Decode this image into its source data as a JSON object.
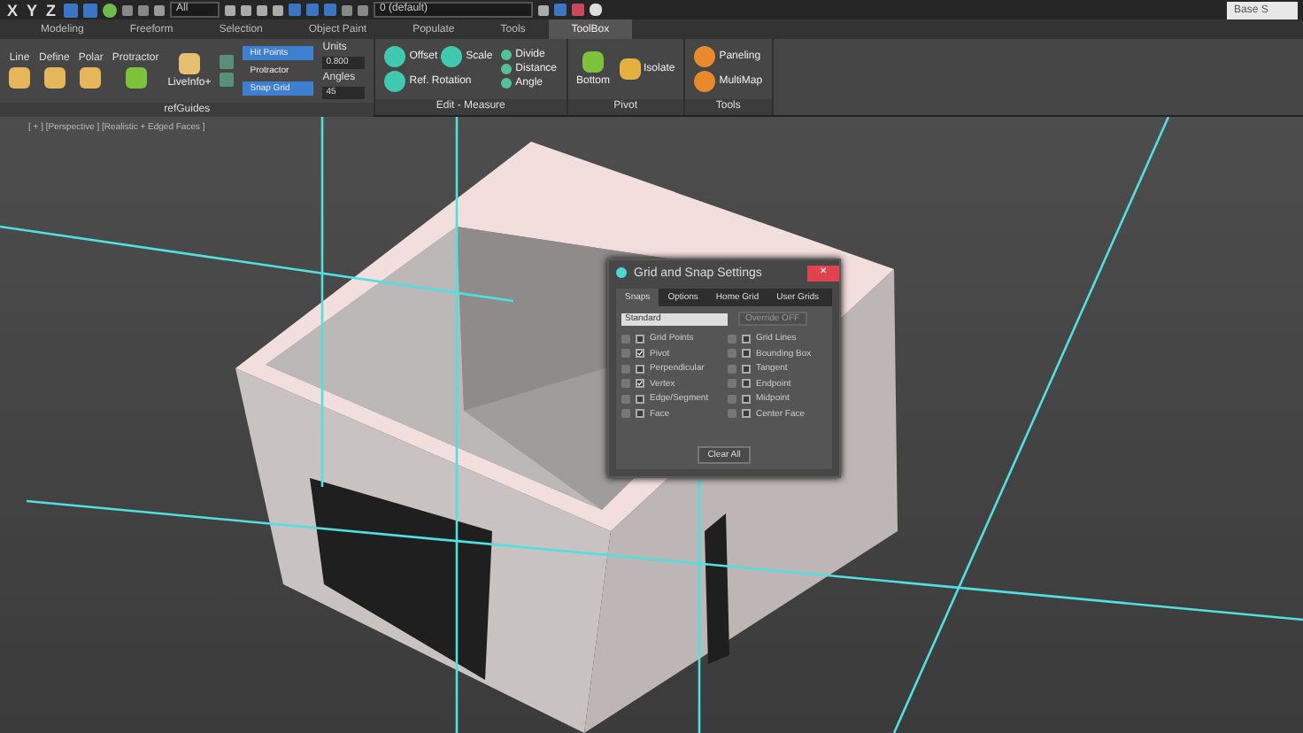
{
  "toolbar": {
    "axes": [
      "X",
      "Y",
      "Z"
    ],
    "selection_filter": "All",
    "layer": "0 (default)",
    "search_field": "Base S"
  },
  "ribbon_tabs": [
    {
      "label": "Modeling",
      "selected": false
    },
    {
      "label": "Freeform",
      "selected": false
    },
    {
      "label": "Selection",
      "selected": false
    },
    {
      "label": "Object Paint",
      "selected": false
    },
    {
      "label": "Populate",
      "selected": false
    },
    {
      "label": "Tools",
      "selected": false
    },
    {
      "label": "ToolBox",
      "selected": true
    }
  ],
  "ribbon": {
    "refguides": {
      "title": "refGuides",
      "tools": [
        "Line",
        "Define",
        "Polar",
        "Protractor"
      ],
      "liveinfo": "LiveInfo+",
      "toggles": [
        {
          "label": "Hit Points",
          "on": true
        },
        {
          "label": "Protractor",
          "on": false
        },
        {
          "label": "Snap Grid",
          "on": true
        }
      ],
      "units_label": "Units",
      "units_value": "0.800",
      "angles_label": "Angles",
      "angles_value": "45"
    },
    "edit_measure": {
      "title": "Edit - Measure",
      "big": [
        "Offset",
        "Scale",
        "Ref. Rotation"
      ],
      "small": [
        "Divide",
        "Distance",
        "Angle"
      ]
    },
    "pivot": {
      "title": "Pivot",
      "buttons": [
        "Bottom",
        "Isolate"
      ]
    },
    "tools": {
      "title": "Tools",
      "buttons": [
        "Paneling",
        "MultiMap"
      ]
    }
  },
  "viewport": {
    "label": "[ + ] [Perspective ] [Realistic + Edged Faces ]"
  },
  "dialog": {
    "title": "Grid and Snap Settings",
    "close": "×",
    "tabs": [
      {
        "label": "Snaps",
        "selected": true
      },
      {
        "label": "Options",
        "selected": false
      },
      {
        "label": "Home Grid",
        "selected": false
      },
      {
        "label": "User Grids",
        "selected": false
      }
    ],
    "preset": "Standard",
    "override": "Override OFF",
    "snaps_left": [
      {
        "label": "Grid Points",
        "checked": false
      },
      {
        "label": "Pivot",
        "checked": true
      },
      {
        "label": "Perpendicular",
        "checked": false
      },
      {
        "label": "Vertex",
        "checked": true
      },
      {
        "label": "Edge/Segment",
        "checked": false
      },
      {
        "label": "Face",
        "checked": false
      }
    ],
    "snaps_right": [
      {
        "label": "Grid Lines",
        "checked": false
      },
      {
        "label": "Bounding Box",
        "checked": false
      },
      {
        "label": "Tangent",
        "checked": false
      },
      {
        "label": "Endpoint",
        "checked": false
      },
      {
        "label": "Midpoint",
        "checked": false
      },
      {
        "label": "Center Face",
        "checked": false
      }
    ],
    "clear": "Clear All"
  }
}
